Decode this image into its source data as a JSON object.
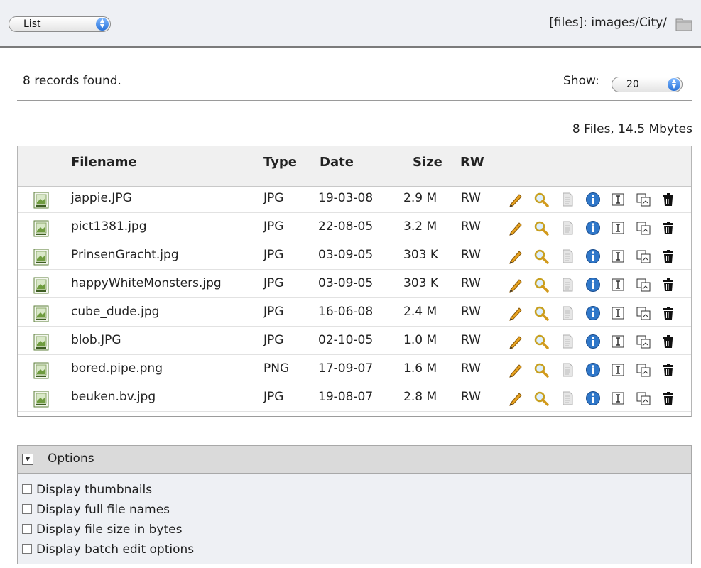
{
  "toolbar": {
    "view_select": "List",
    "path": "[files]: images/City/"
  },
  "status": {
    "records_found": "8 records found.",
    "show_label": "Show:",
    "show_value": "20",
    "summary": "8 Files, 14.5 Mbytes"
  },
  "table": {
    "columns": [
      "Filename",
      "Type",
      "Date",
      "Size",
      "RW"
    ],
    "rows": [
      {
        "filename": "jappie.JPG",
        "type": "JPG",
        "date": "19-03-08",
        "size": "2.9 M",
        "rw": "RW"
      },
      {
        "filename": "pict1381.jpg",
        "type": "JPG",
        "date": "22-08-05",
        "size": "3.2 M",
        "rw": "RW"
      },
      {
        "filename": "PrinsenGracht.jpg",
        "type": "JPG",
        "date": "03-09-05",
        "size": "303 K",
        "rw": "RW"
      },
      {
        "filename": "happyWhiteMonsters.jpg",
        "type": "JPG",
        "date": "03-09-05",
        "size": "303 K",
        "rw": "RW"
      },
      {
        "filename": "cube_dude.jpg",
        "type": "JPG",
        "date": "16-06-08",
        "size": "2.4 M",
        "rw": "RW"
      },
      {
        "filename": "blob.JPG",
        "type": "JPG",
        "date": "02-10-05",
        "size": "1.0 M",
        "rw": "RW"
      },
      {
        "filename": "bored.pipe.png",
        "type": "PNG",
        "date": "17-09-07",
        "size": "1.6 M",
        "rw": "RW"
      },
      {
        "filename": "beuken.bv.jpg",
        "type": "JPG",
        "date": "19-08-07",
        "size": "2.8 M",
        "rw": "RW"
      }
    ],
    "row_actions": [
      "pencil-icon",
      "magnifier-icon",
      "file-gray-icon",
      "info-icon",
      "rename-icon",
      "copy-icon",
      "trash-icon"
    ]
  },
  "options": {
    "title": "Options",
    "items": [
      {
        "label": "Display thumbnails",
        "checked": false
      },
      {
        "label": "Display full file names",
        "checked": false
      },
      {
        "label": "Display file size in bytes",
        "checked": false
      },
      {
        "label": "Display batch edit options",
        "checked": false
      }
    ]
  },
  "colors": {
    "accent": "#2a73d9",
    "pencil": "#e8a21e",
    "info": "#2f77c9"
  }
}
